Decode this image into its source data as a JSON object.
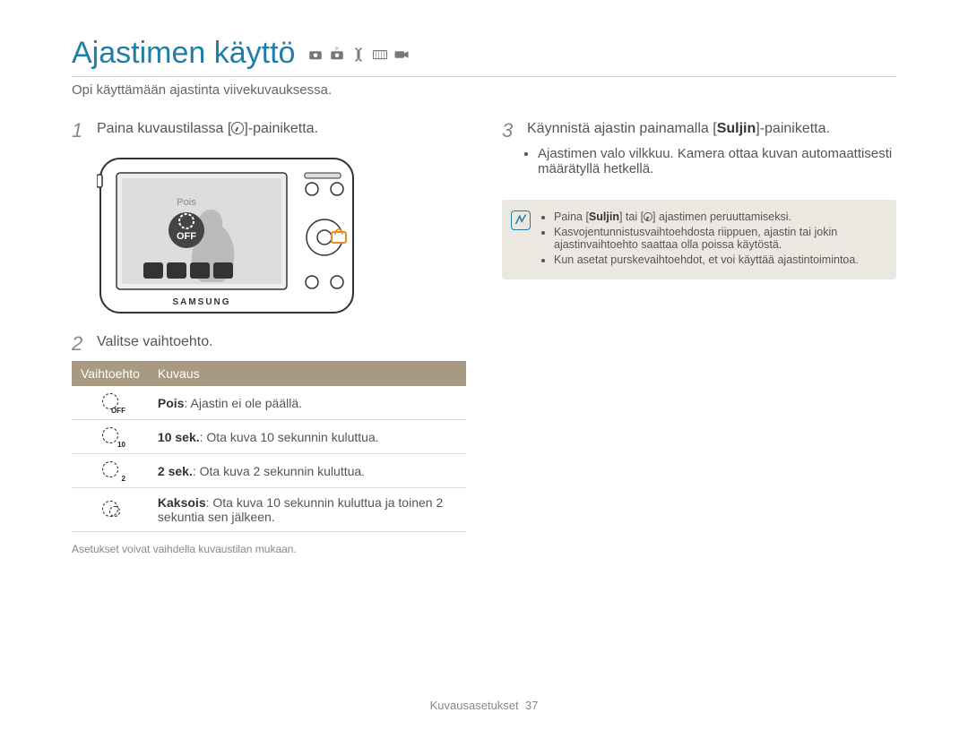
{
  "title": "Ajastimen käyttö",
  "subtitle": "Opi käyttämään ajastinta viivekuvauksessa.",
  "steps": {
    "s1": "Paina kuvaustilassa [",
    "s1b": "]-painiketta.",
    "s2": "Valitse vaihtoehto.",
    "s3a": "Käynnistä ajastin painamalla [",
    "s3b": "Suljin",
    "s3c": "]-painiketta."
  },
  "bullets_right": [
    "Ajastimen valo vilkkuu. Kamera ottaa kuvan automaattisesti määrätyllä hetkellä."
  ],
  "table": {
    "head_option": "Vaihtoehto",
    "head_desc": "Kuvaus",
    "rows": [
      {
        "icon_sub": "OFF",
        "bold": "Pois",
        "rest": ": Ajastin ei ole päällä."
      },
      {
        "icon_sub": "10",
        "bold": "10 sek.",
        "rest": ": Ota kuva 10 sekunnin kuluttua."
      },
      {
        "icon_sub": "2",
        "bold": "2 sek.",
        "rest": ": Ota kuva 2 sekunnin kuluttua."
      },
      {
        "icon_sub": "",
        "bold": "Kaksois",
        "rest": ": Ota kuva 10 sekunnin kuluttua ja toinen 2 sekuntia sen jälkeen."
      }
    ]
  },
  "footnote": "Asetukset voivat vaihdella kuvaustilan mukaan.",
  "note_items": [
    "Paina [<b>Suljin</b>] tai [ ◷ ] ajastimen peruuttamiseksi.",
    "Kasvojentunnistusvaihtoehdosta riippuen, ajastin tai jokin ajastinvaihtoehto saattaa olla poissa käytöstä.",
    "Kun asetat purskevaihtoehdot, et voi käyttää ajastintoimintoa."
  ],
  "camera": {
    "brand": "SAMSUNG",
    "screen_label": "Pois",
    "screen_off": "OFF"
  },
  "footer": {
    "section": "Kuvausasetukset",
    "page": "37"
  }
}
